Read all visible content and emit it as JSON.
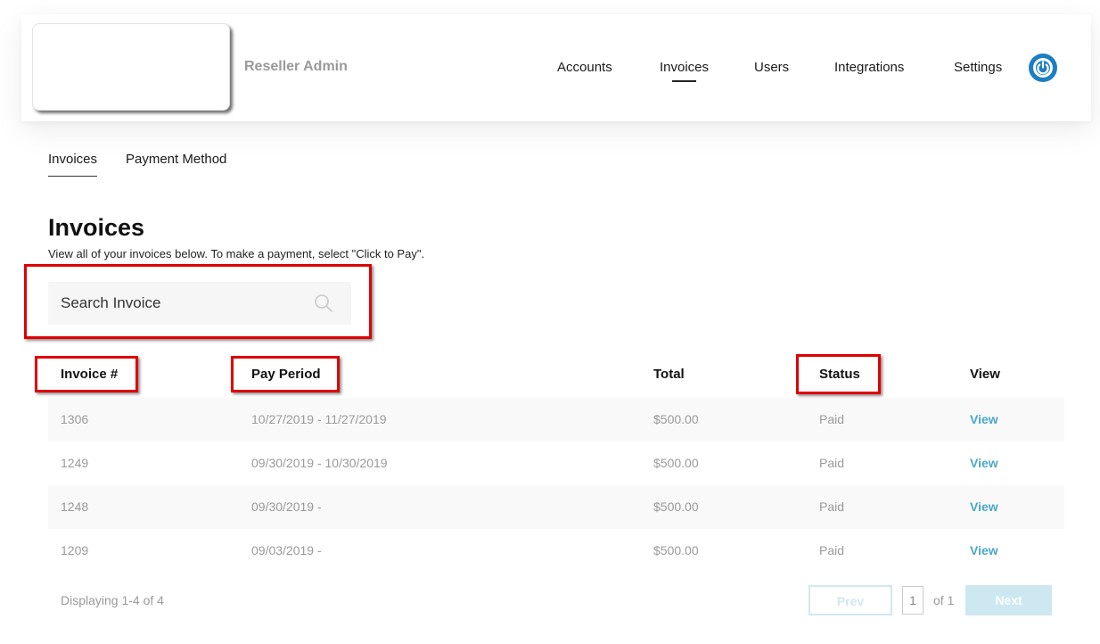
{
  "header": {
    "app_title": "Reseller Admin",
    "nav": [
      {
        "label": "Accounts",
        "active": false
      },
      {
        "label": "Invoices",
        "active": true
      },
      {
        "label": "Users",
        "active": false
      },
      {
        "label": "Integrations",
        "active": false
      },
      {
        "label": "Settings",
        "active": false
      }
    ],
    "power_icon": "power-icon",
    "accent_color": "#1d7ec4"
  },
  "sub_tabs": [
    {
      "label": "Invoices",
      "active": true
    },
    {
      "label": "Payment Method",
      "active": false
    }
  ],
  "page": {
    "title": "Invoices",
    "description": "View all of your invoices below. To make a payment, select \"Click to Pay\"."
  },
  "search": {
    "placeholder": "Search Invoice",
    "value": "",
    "icon": "search-icon"
  },
  "table": {
    "columns": [
      "Invoice #",
      "Pay Period",
      "Total",
      "Status",
      "View"
    ],
    "rows": [
      {
        "invoice": "1306",
        "period": "10/27/2019 - 11/27/2019",
        "total": "$500.00",
        "status": "Paid",
        "view": "View"
      },
      {
        "invoice": "1249",
        "period": "09/30/2019 - 10/30/2019",
        "total": "$500.00",
        "status": "Paid",
        "view": "View"
      },
      {
        "invoice": "1248",
        "period": "09/30/2019 -",
        "total": "$500.00",
        "status": "Paid",
        "view": "View"
      },
      {
        "invoice": "1209",
        "period": "09/03/2019 -",
        "total": "$500.00",
        "status": "Paid",
        "view": "View"
      }
    ]
  },
  "footer": {
    "count_text": "Displaying 1-4 of 4"
  },
  "pagination": {
    "prev_label": "Prev",
    "current_page": "1",
    "of_text": "of 1",
    "next_label": "Next"
  },
  "annotation_color": "#e00000"
}
